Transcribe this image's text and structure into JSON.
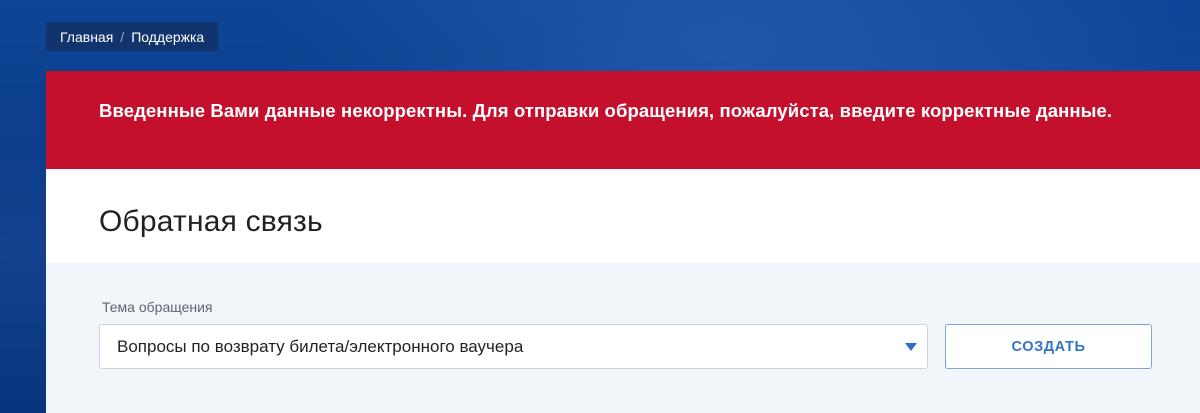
{
  "breadcrumb": {
    "items": [
      "Главная",
      "Поддержка"
    ],
    "separator": "/"
  },
  "alert": {
    "message": "Введенные Вами данные некорректны. Для отправки обращения, пожалуйста, введите корректные данные.",
    "background_color": "#c4102c"
  },
  "form": {
    "title": "Обратная связь",
    "topic_label": "Тема обращения",
    "topic_value": "Вопросы по возврату билета/электронного ваучера",
    "topic_dropdown_icon": "caret-down-icon",
    "submit_label": "СОЗДАТЬ"
  },
  "colors": {
    "accent": "#3474c4",
    "error": "#c4102c",
    "background": "#0b3f8d",
    "form_background": "#f2f6fb"
  }
}
